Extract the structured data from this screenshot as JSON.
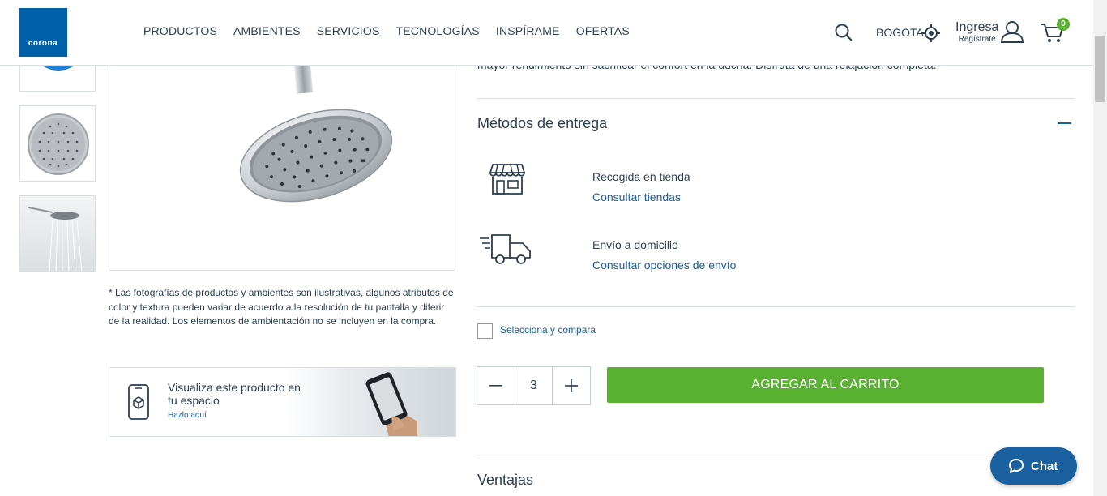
{
  "header": {
    "logo_text": "corona",
    "nav": [
      "PRODUCTOS",
      "AMBIENTES",
      "SERVICIOS",
      "TECNOLOGÍAS",
      "INSPÍRAME",
      "OFERTAS"
    ],
    "city": "BOGOTA",
    "login_label": "Ingresa",
    "register_label": "Regístrate",
    "cart_count": "0"
  },
  "gallery": {
    "disclaimer": "* Las fotografías de productos y ambientes son ilustrativas, algunos atributos de color y textura pueden variar de acuerdo a la resolución de tu pantalla y diferir de la realidad. Los elementos de ambientación no se incluyen en la compra.",
    "ar_banner": {
      "title": "Visualiza este producto en tu espacio",
      "link": "Hazlo aquí"
    }
  },
  "product": {
    "intro_text": "mayor rendimiento sin sacrificar el confort en la ducha. Disfruta de una relajación completa.",
    "delivery": {
      "title": "Métodos de entrega",
      "store_pickup": {
        "label": "Recogida en tienda",
        "link": "Consultar tiendas"
      },
      "home_delivery": {
        "label": "Envío a domicilio",
        "link": "Consultar opciones de envío"
      }
    },
    "compare_label": "Selecciona y compara",
    "quantity": "3",
    "add_to_cart": "AGREGAR AL CARRITO",
    "advantages_title": "Ventajas"
  },
  "chat": {
    "label": "Chat"
  },
  "colors": {
    "brand_blue": "#0061a8",
    "link_blue": "#1a5fa0",
    "cta_green": "#5ab031",
    "text": "#2c3e50"
  }
}
